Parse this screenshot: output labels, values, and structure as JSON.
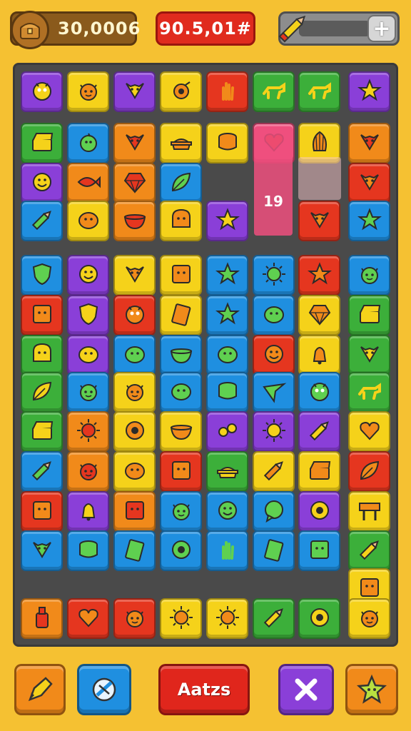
{
  "hud": {
    "coins": "30,0006",
    "score": "90.5,01#",
    "energy_icon": "pencil-icon",
    "plus_label": "+"
  },
  "board": {
    "highlight_label": "19",
    "tiles": [
      {
        "c": "#8a3fd8",
        "i": "monster"
      },
      {
        "c": "#f5d21a",
        "i": "cat"
      },
      {
        "c": "#8a3fd8",
        "i": "fox"
      },
      {
        "c": "#f5d21a",
        "i": "bug"
      },
      {
        "c": "#e5361f",
        "i": "hand"
      },
      {
        "c": "#3caf3a",
        "i": "dog"
      },
      {
        "c": "#3caf3a",
        "i": "dog"
      },
      {
        "c": "#8a3fd8",
        "i": "star"
      },
      {
        "c": "#3caf3a",
        "i": "chest"
      },
      {
        "c": "#1f8fe0",
        "i": "chick"
      },
      {
        "c": "#f18a1a",
        "i": "fox"
      },
      {
        "c": "#f5d21a",
        "i": "pot"
      },
      {
        "c": "#f5d21a",
        "i": "drum"
      },
      {
        "c": "#ef4f7e",
        "i": "heart"
      },
      {
        "c": "#f5d21a",
        "i": "shell"
      },
      {
        "c": "#f18a1a",
        "i": "fox"
      },
      {
        "c": "#8a3fd8",
        "i": "smile"
      },
      {
        "c": "#f18a1a",
        "i": "fish"
      },
      {
        "c": "#f18a1a",
        "i": "gem"
      },
      {
        "c": "#1f8fe0",
        "i": "leaf"
      },
      {
        "c": "#e5361f",
        "i": "fox"
      },
      {
        "c": "#1f8fe0",
        "i": "pencil"
      },
      {
        "c": "#f5d21a",
        "i": "blob"
      },
      {
        "c": "#f18a1a",
        "i": "bowl"
      },
      {
        "c": "#f5d21a",
        "i": "bread"
      },
      {
        "c": "#8a3fd8",
        "i": "star"
      },
      {
        "c": "#e5361f",
        "i": "fox"
      },
      {
        "c": "#1f8fe0",
        "i": "star"
      },
      {
        "c": "#1f8fe0",
        "i": "shield"
      },
      {
        "c": "#8a3fd8",
        "i": "smile"
      },
      {
        "c": "#f5d21a",
        "i": "fox"
      },
      {
        "c": "#f5d21a",
        "i": "box"
      },
      {
        "c": "#1f8fe0",
        "i": "star"
      },
      {
        "c": "#1f8fe0",
        "i": "sun"
      },
      {
        "c": "#e5361f",
        "i": "star"
      },
      {
        "c": "#1f8fe0",
        "i": "cat"
      },
      {
        "c": "#e5361f",
        "i": "box"
      },
      {
        "c": "#8a3fd8",
        "i": "shield"
      },
      {
        "c": "#e5361f",
        "i": "monster"
      },
      {
        "c": "#f5d21a",
        "i": "card"
      },
      {
        "c": "#1f8fe0",
        "i": "star"
      },
      {
        "c": "#1f8fe0",
        "i": "blob"
      },
      {
        "c": "#f5d21a",
        "i": "gem"
      },
      {
        "c": "#3caf3a",
        "i": "chest"
      },
      {
        "c": "#3caf3a",
        "i": "bread"
      },
      {
        "c": "#8a3fd8",
        "i": "blob"
      },
      {
        "c": "#1f8fe0",
        "i": "blob"
      },
      {
        "c": "#1f8fe0",
        "i": "bowl"
      },
      {
        "c": "#1f8fe0",
        "i": "blob"
      },
      {
        "c": "#e5361f",
        "i": "smile"
      },
      {
        "c": "#f5d21a",
        "i": "bell"
      },
      {
        "c": "#3caf3a",
        "i": "fox"
      },
      {
        "c": "#3caf3a",
        "i": "leaf"
      },
      {
        "c": "#1f8fe0",
        "i": "cat"
      },
      {
        "c": "#f5d21a",
        "i": "cat"
      },
      {
        "c": "#1f8fe0",
        "i": "blob"
      },
      {
        "c": "#1f8fe0",
        "i": "drum"
      },
      {
        "c": "#1f8fe0",
        "i": "flag"
      },
      {
        "c": "#1f8fe0",
        "i": "monster"
      },
      {
        "c": "#3caf3a",
        "i": "dog"
      },
      {
        "c": "#3caf3a",
        "i": "chest"
      },
      {
        "c": "#f18a1a",
        "i": "sun"
      },
      {
        "c": "#f5d21a",
        "i": "donut"
      },
      {
        "c": "#f5d21a",
        "i": "bowl"
      },
      {
        "c": "#8a3fd8",
        "i": "coins"
      },
      {
        "c": "#8a3fd8",
        "i": "sun"
      },
      {
        "c": "#8a3fd8",
        "i": "pencil"
      },
      {
        "c": "#f5d21a",
        "i": "heart"
      },
      {
        "c": "#1f8fe0",
        "i": "pencil"
      },
      {
        "c": "#f18a1a",
        "i": "cat"
      },
      {
        "c": "#f5d21a",
        "i": "blob"
      },
      {
        "c": "#e5361f",
        "i": "box"
      },
      {
        "c": "#3caf3a",
        "i": "pot"
      },
      {
        "c": "#f5d21a",
        "i": "pencil"
      },
      {
        "c": "#f5d21a",
        "i": "chest"
      },
      {
        "c": "#e5361f",
        "i": "leaf"
      },
      {
        "c": "#e5361f",
        "i": "box"
      },
      {
        "c": "#8a3fd8",
        "i": "bell"
      },
      {
        "c": "#f18a1a",
        "i": "box"
      },
      {
        "c": "#1f8fe0",
        "i": "cat"
      },
      {
        "c": "#1f8fe0",
        "i": "smile"
      },
      {
        "c": "#1f8fe0",
        "i": "bubble"
      },
      {
        "c": "#8a3fd8",
        "i": "donut"
      },
      {
        "c": "#f5d21a",
        "i": "sign"
      },
      {
        "c": "#1f8fe0",
        "i": "fox"
      },
      {
        "c": "#1f8fe0",
        "i": "drum"
      },
      {
        "c": "#1f8fe0",
        "i": "card"
      },
      {
        "c": "#1f8fe0",
        "i": "donut"
      },
      {
        "c": "#1f8fe0",
        "i": "hand"
      },
      {
        "c": "#1f8fe0",
        "i": "card"
      },
      {
        "c": "#1f8fe0",
        "i": "box"
      },
      {
        "c": "#3caf3a",
        "i": "pencil"
      },
      {
        "c": "#f5d21a",
        "i": "box"
      },
      {
        "c": "#f18a1a",
        "i": "bottle"
      },
      {
        "c": "#e5361f",
        "i": "heart"
      },
      {
        "c": "#e5361f",
        "i": "cat"
      },
      {
        "c": "#f5d21a",
        "i": "sun"
      },
      {
        "c": "#f5d21a",
        "i": "sun"
      },
      {
        "c": "#3caf3a",
        "i": "pencil"
      },
      {
        "c": "#3caf3a",
        "i": "donut"
      },
      {
        "c": "#f5d21a",
        "i": "cat"
      }
    ]
  },
  "actions": {
    "main_label": "Aatzs",
    "draw_icon": "pencil-icon",
    "swap_icon": "swap-icon",
    "cancel_icon": "close-icon",
    "bonus_icon": "star-icon"
  }
}
